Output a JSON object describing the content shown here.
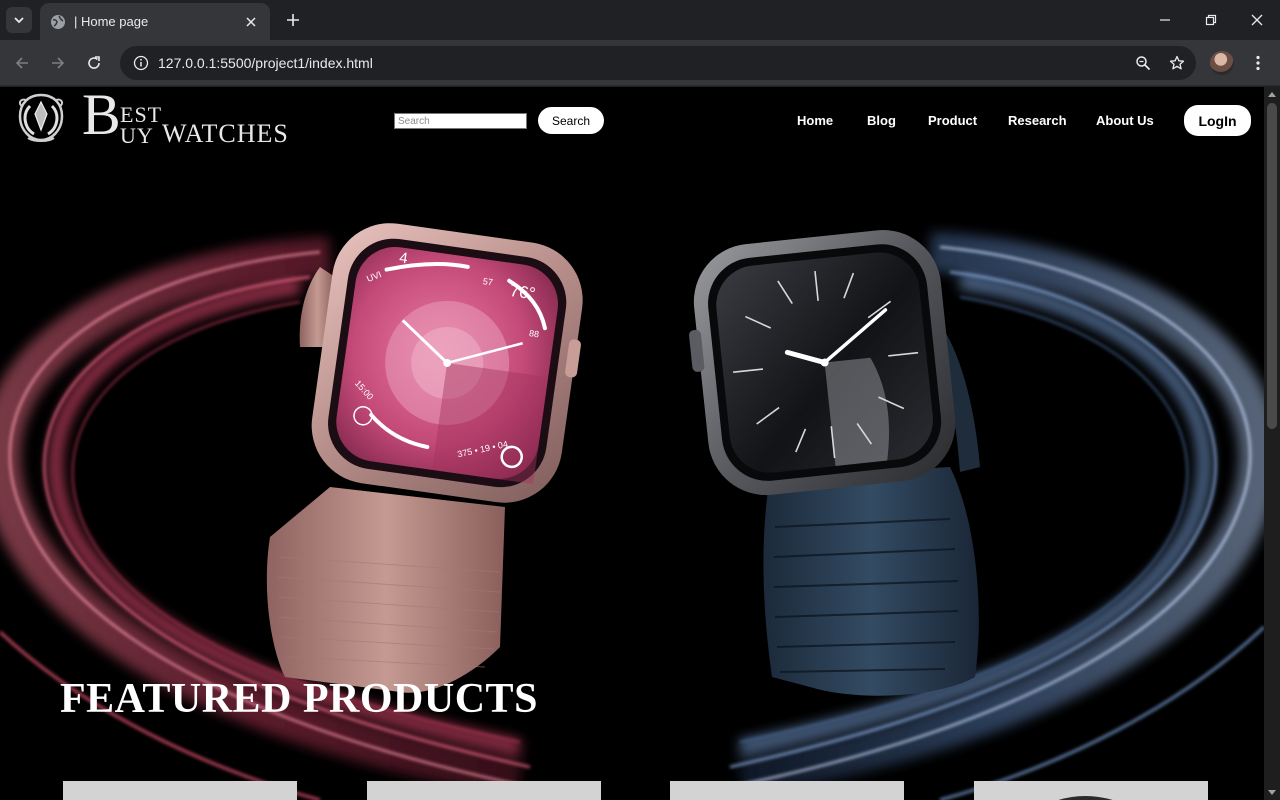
{
  "browser": {
    "tab_title": "| Home page",
    "url": "127.0.0.1:5500/project1/index.html"
  },
  "site": {
    "logo": {
      "letter_b": "B",
      "est": "EST",
      "uy": "UY",
      "watches": "WATCHES"
    },
    "search": {
      "placeholder": "Search",
      "button_label": "Search"
    },
    "nav": [
      {
        "label": "Home"
      },
      {
        "label": "Blog"
      },
      {
        "label": "Product"
      },
      {
        "label": "Research"
      },
      {
        "label": "About Us"
      }
    ],
    "login_label": "LogIn",
    "featured_title": "FEATURED PRODUCTS"
  },
  "hero_watches": {
    "pink": {
      "complications": {
        "top": "4",
        "uvi": "UVI",
        "small": "57",
        "temp": "76°",
        "range": "88",
        "timer": "15:00",
        "activity": "375 • 19 • 04"
      }
    }
  },
  "colors": {
    "page_bg": "#000000",
    "pink_swirl": "#e0506e",
    "blue_swirl": "#6f95c8",
    "button_bg": "#ffffff",
    "card_bg": "#d3d3d3"
  }
}
